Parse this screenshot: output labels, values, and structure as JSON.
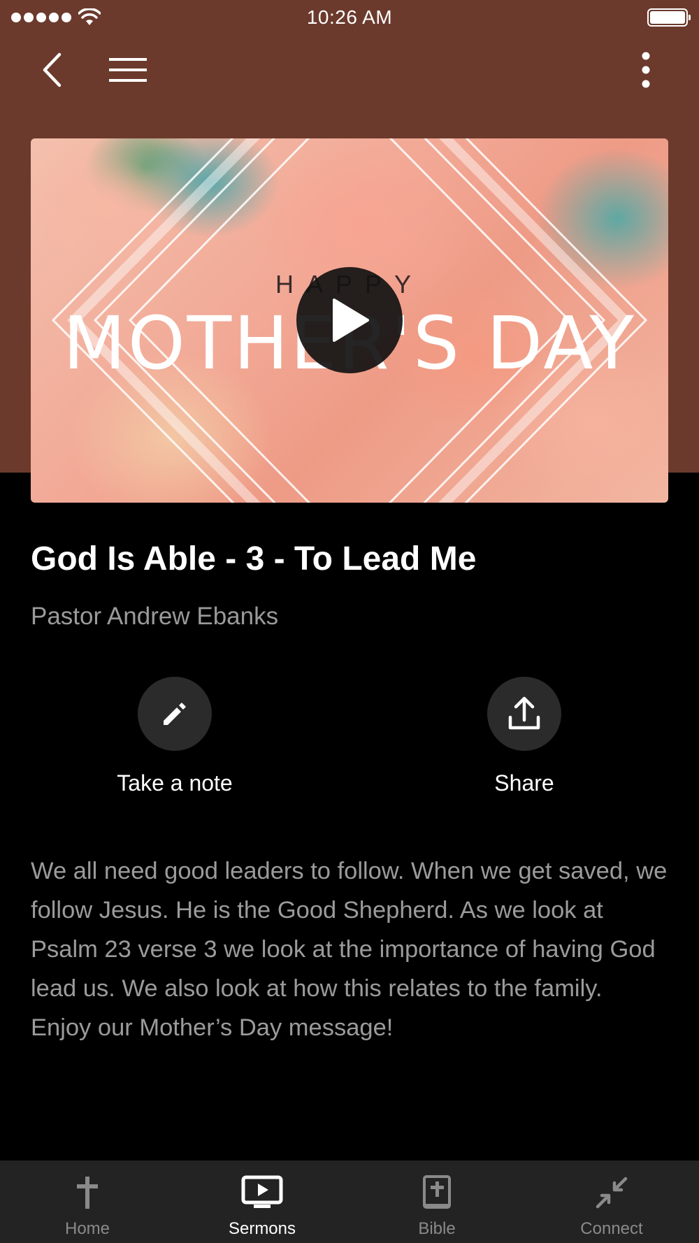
{
  "status_bar": {
    "time": "10:26 AM"
  },
  "nav": {
    "back_icon": "chevron-left-icon",
    "menu_icon": "hamburger-menu-icon",
    "more_icon": "more-vertical-icon"
  },
  "colors": {
    "header_background": "#6b3a2c",
    "page_background": "#000000",
    "tab_bar_background": "#232323",
    "action_circle": "#2b2b2b",
    "secondary_text": "#9b9b9b"
  },
  "hero": {
    "overline": "HAPPY",
    "title": "MOTHER'S DAY",
    "play_icon": "play-icon"
  },
  "sermon": {
    "title": "God Is Able - 3 - To Lead Me",
    "speaker": "Pastor Andrew Ebanks",
    "description": "We all need good leaders to follow. When we get saved, we follow Jesus. He is the Good Shepherd. As we look at Psalm 23 verse 3 we look at the importance of having God lead us. We also look at how this relates to the family. Enjoy our Mother’s Day message!"
  },
  "actions": {
    "note": {
      "label": "Take a note",
      "icon": "pencil-icon"
    },
    "share": {
      "label": "Share",
      "icon": "share-upload-icon"
    }
  },
  "tabs": [
    {
      "label": "Home",
      "icon": "cross-icon",
      "active": false
    },
    {
      "label": "Sermons",
      "icon": "tv-play-icon",
      "active": true
    },
    {
      "label": "Bible",
      "icon": "bible-book-icon",
      "active": false
    },
    {
      "label": "Connect",
      "icon": "connect-arrows-icon",
      "active": false
    }
  ]
}
